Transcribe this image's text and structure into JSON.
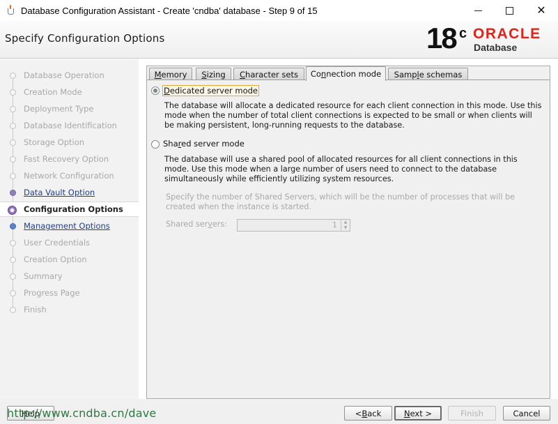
{
  "window": {
    "title": "Database Configuration Assistant - Create 'cndba' database - Step 9 of 15",
    "minimize_icon": "minimize-icon",
    "maximize_icon": "maximize-icon",
    "close_icon": "close-icon",
    "close_glyph": "✕"
  },
  "header": {
    "page_title": "Specify Configuration Options",
    "logo": {
      "version": "18",
      "superscript": "c",
      "brand": "ORACLE",
      "product": "Database",
      "brand_color": "#e2231a"
    }
  },
  "sidebar": {
    "steps": [
      {
        "label": "Database Operation",
        "state": "disabled"
      },
      {
        "label": "Creation Mode",
        "state": "disabled"
      },
      {
        "label": "Deployment Type",
        "state": "disabled"
      },
      {
        "label": "Database Identification",
        "state": "disabled"
      },
      {
        "label": "Storage Option",
        "state": "disabled"
      },
      {
        "label": "Fast Recovery Option",
        "state": "disabled"
      },
      {
        "label": "Network Configuration",
        "state": "disabled"
      },
      {
        "label": "Data Vault Option",
        "state": "link"
      },
      {
        "label": "Configuration Options",
        "state": "current"
      },
      {
        "label": "Management Options",
        "state": "link"
      },
      {
        "label": "User Credentials",
        "state": "disabled"
      },
      {
        "label": "Creation Option",
        "state": "disabled"
      },
      {
        "label": "Summary",
        "state": "disabled"
      },
      {
        "label": "Progress Page",
        "state": "disabled"
      },
      {
        "label": "Finish",
        "state": "disabled"
      }
    ]
  },
  "tabs": [
    {
      "pre": "",
      "key": "M",
      "post": "emory"
    },
    {
      "pre": "",
      "key": "S",
      "post": "izing"
    },
    {
      "pre": "",
      "key": "C",
      "post": "haracter sets"
    },
    {
      "pre": "Co",
      "key": "n",
      "post": "nection mode"
    },
    {
      "pre": "Samp",
      "key": "l",
      "post": "e schemas"
    }
  ],
  "active_tab": "Connection mode",
  "connection": {
    "dedicated": {
      "pre": "",
      "key": "D",
      "post": "edicated server mode",
      "selected": true,
      "description": "The database will allocate a dedicated resource for each client connection in this mode. Use this mode when the number of total client connections is expected to be small or when clients will be making persistent, long-running requests to the database."
    },
    "shared": {
      "pre": "Sha",
      "key": "r",
      "post": "ed server mode",
      "selected": false,
      "description": "The database will use a shared pool of allocated resources for all client connections in this mode.  Use this mode when a large number of users need to connect to the database simultaneously while efficiently utilizing system resources.",
      "servers_hint": "Specify the number of Shared Servers, which will be the number of processes that will be created when the instance is started.",
      "servers_label_pre": "Shared ser",
      "servers_label_key": "v",
      "servers_label_post": "ers:",
      "servers_value": "1"
    }
  },
  "buttons": {
    "help": "Help",
    "back_pre": "< ",
    "back_key": "B",
    "back_post": "ack",
    "next_pre": "",
    "next_key": "N",
    "next_post": "ext >",
    "finish": "Finish",
    "cancel": "Cancel"
  },
  "watermark": "http://www.cndba.cn/dave"
}
